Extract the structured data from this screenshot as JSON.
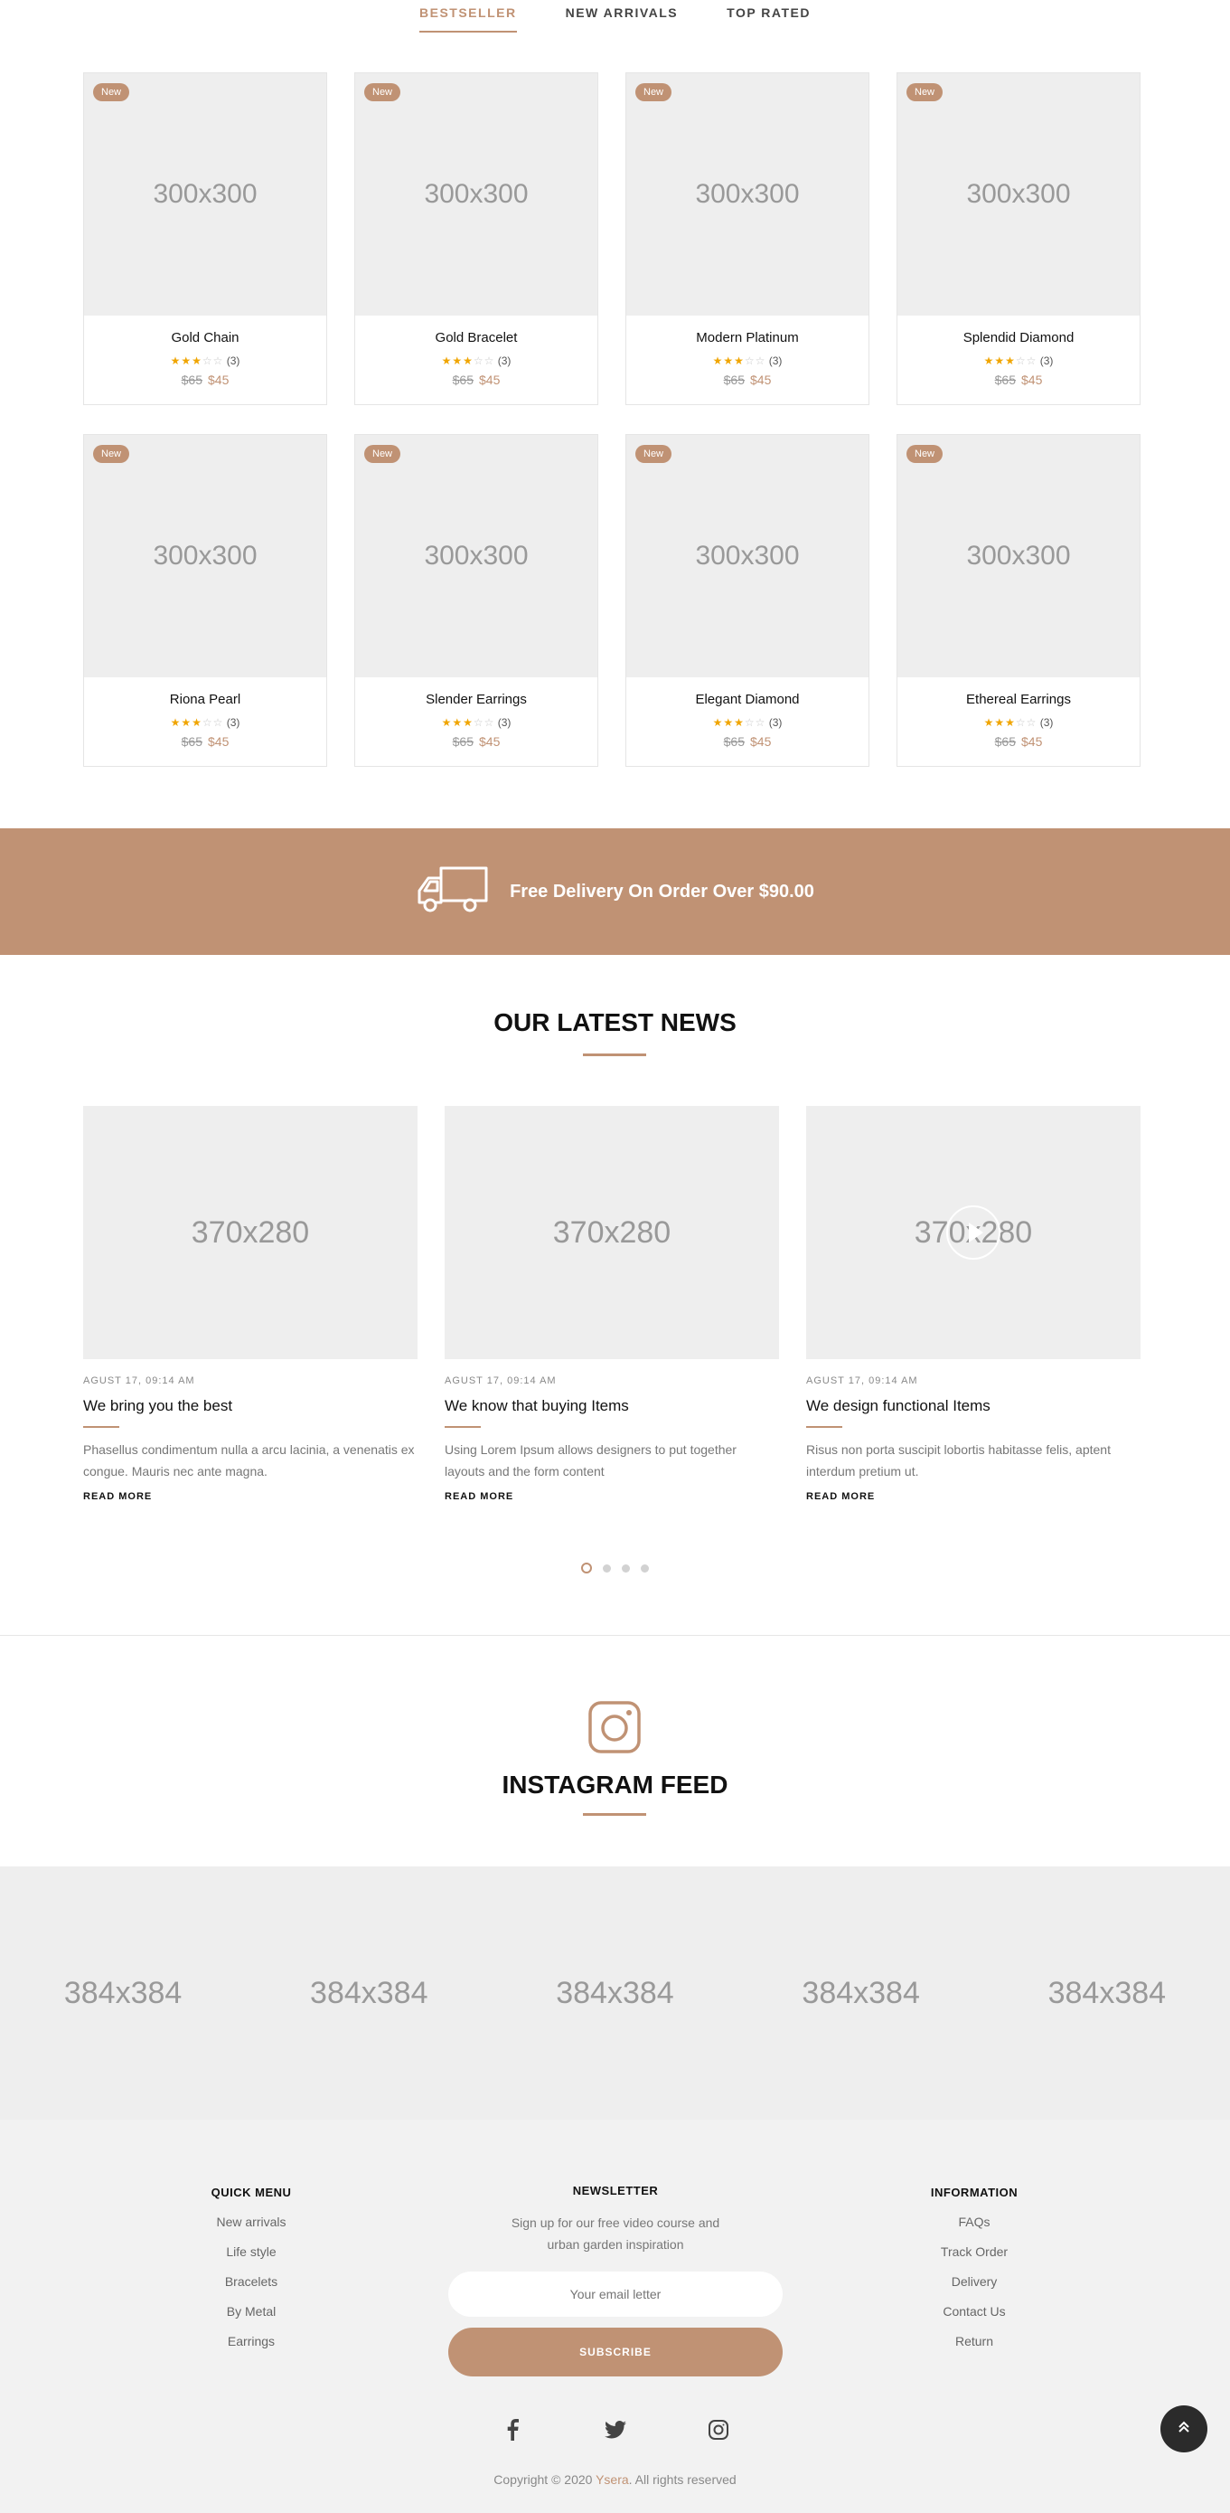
{
  "tabs": [
    {
      "label": "BESTSELLER",
      "active": true
    },
    {
      "label": "NEW ARRIVALS",
      "active": false
    },
    {
      "label": "TOP RATED",
      "active": false
    }
  ],
  "products": [
    {
      "badge": "New",
      "image": "300x300",
      "name": "Gold Chain",
      "reviews": "(3)",
      "old_price": "$65",
      "price": "$45",
      "stars": 3
    },
    {
      "badge": "New",
      "image": "300x300",
      "name": "Gold Bracelet",
      "reviews": "(3)",
      "old_price": "$65",
      "price": "$45",
      "stars": 3
    },
    {
      "badge": "New",
      "image": "300x300",
      "name": "Modern Platinum",
      "reviews": "(3)",
      "old_price": "$65",
      "price": "$45",
      "stars": 3
    },
    {
      "badge": "New",
      "image": "300x300",
      "name": "Splendid Diamond",
      "reviews": "(3)",
      "old_price": "$65",
      "price": "$45",
      "stars": 3
    },
    {
      "badge": "New",
      "image": "300x300",
      "name": "Riona Pearl",
      "reviews": "(3)",
      "old_price": "$65",
      "price": "$45",
      "stars": 3
    },
    {
      "badge": "New",
      "image": "300x300",
      "name": "Slender Earrings",
      "reviews": "(3)",
      "old_price": "$65",
      "price": "$45",
      "stars": 3
    },
    {
      "badge": "New",
      "image": "300x300",
      "name": "Elegant Diamond",
      "reviews": "(3)",
      "old_price": "$65",
      "price": "$45",
      "stars": 3
    },
    {
      "badge": "New",
      "image": "300x300",
      "name": "Ethereal Earrings",
      "reviews": "(3)",
      "old_price": "$65",
      "price": "$45",
      "stars": 3
    }
  ],
  "banner": {
    "text": "Free Delivery On Order Over $90.00",
    "icon": "delivery-truck-icon"
  },
  "news_section": {
    "title": "OUR LATEST NEWS",
    "items": [
      {
        "image": "370x280",
        "date": "AGUST 17, 09:14 AM",
        "title": "We bring you the best",
        "desc": "Phasellus condimentum nulla a arcu lacinia, a venenatis ex congue. Mauris nec ante magna.",
        "more": "READ MORE"
      },
      {
        "image": "370x280",
        "date": "AGUST 17, 09:14 AM",
        "title": "We know that buying Items",
        "desc": "Using Lorem Ipsum allows designers to put together layouts and the form content",
        "more": "READ MORE"
      },
      {
        "image": "370x280",
        "date": "AGUST 17, 09:14 AM",
        "title": "We design functional Items",
        "desc": "Risus non porta suscipit lobortis habitasse felis, aptent interdum pretium ut.",
        "more": "READ MORE"
      }
    ]
  },
  "instagram": {
    "title": "INSTAGRAM FEED",
    "images": [
      "384x384",
      "384x384",
      "384x384",
      "384x384",
      "384x384"
    ]
  },
  "footer": {
    "quick_menu": {
      "title": "QUICK MENU",
      "links": [
        "New arrivals",
        "Life style",
        "Bracelets",
        "By Metal",
        "Earrings"
      ]
    },
    "newsletter": {
      "title": "NEWSLETTER",
      "desc_line1": "Sign up for our free video course and",
      "desc_line2": "urban garden inspiration",
      "placeholder": "Your email letter",
      "button": "SUBSCRIBE"
    },
    "information": {
      "title": "INFORMATION",
      "links": [
        "FAQs",
        "Track Order",
        "Delivery",
        "Contact Us",
        "Return"
      ]
    },
    "copyright_prefix": "Copyright © 2020 ",
    "brand": "Ysera",
    "copyright_suffix": ". All rights reserved"
  },
  "colors": {
    "accent": "#c09274",
    "placeholder_bg": "#eeeeee",
    "footer_bg": "#f2f2f2"
  }
}
